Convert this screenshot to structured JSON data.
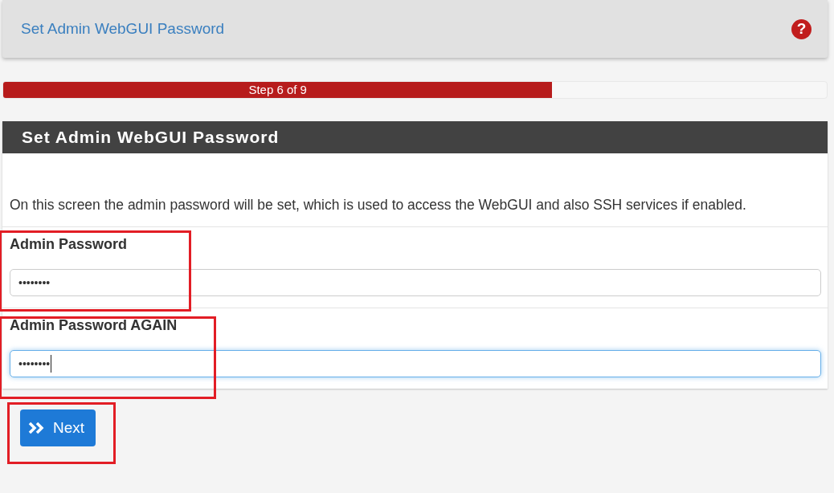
{
  "header": {
    "title": "Set Admin WebGUI Password",
    "help": "?"
  },
  "progress": {
    "label": "Step 6 of 9",
    "level": 0.6667
  },
  "panel": {
    "title": "Set Admin WebGUI Password",
    "description": "On this screen the admin password will be set, which is used to access the WebGUI and also SSH services if enabled.",
    "fields": [
      {
        "label": "Admin Password",
        "value": "••••••••",
        "focused": false,
        "highlighted": true
      },
      {
        "label": "Admin Password AGAIN",
        "value": "••••••••",
        "focused": true,
        "highlighted": true
      }
    ]
  },
  "next_button": {
    "label": "Next",
    "highlighted": true
  }
}
